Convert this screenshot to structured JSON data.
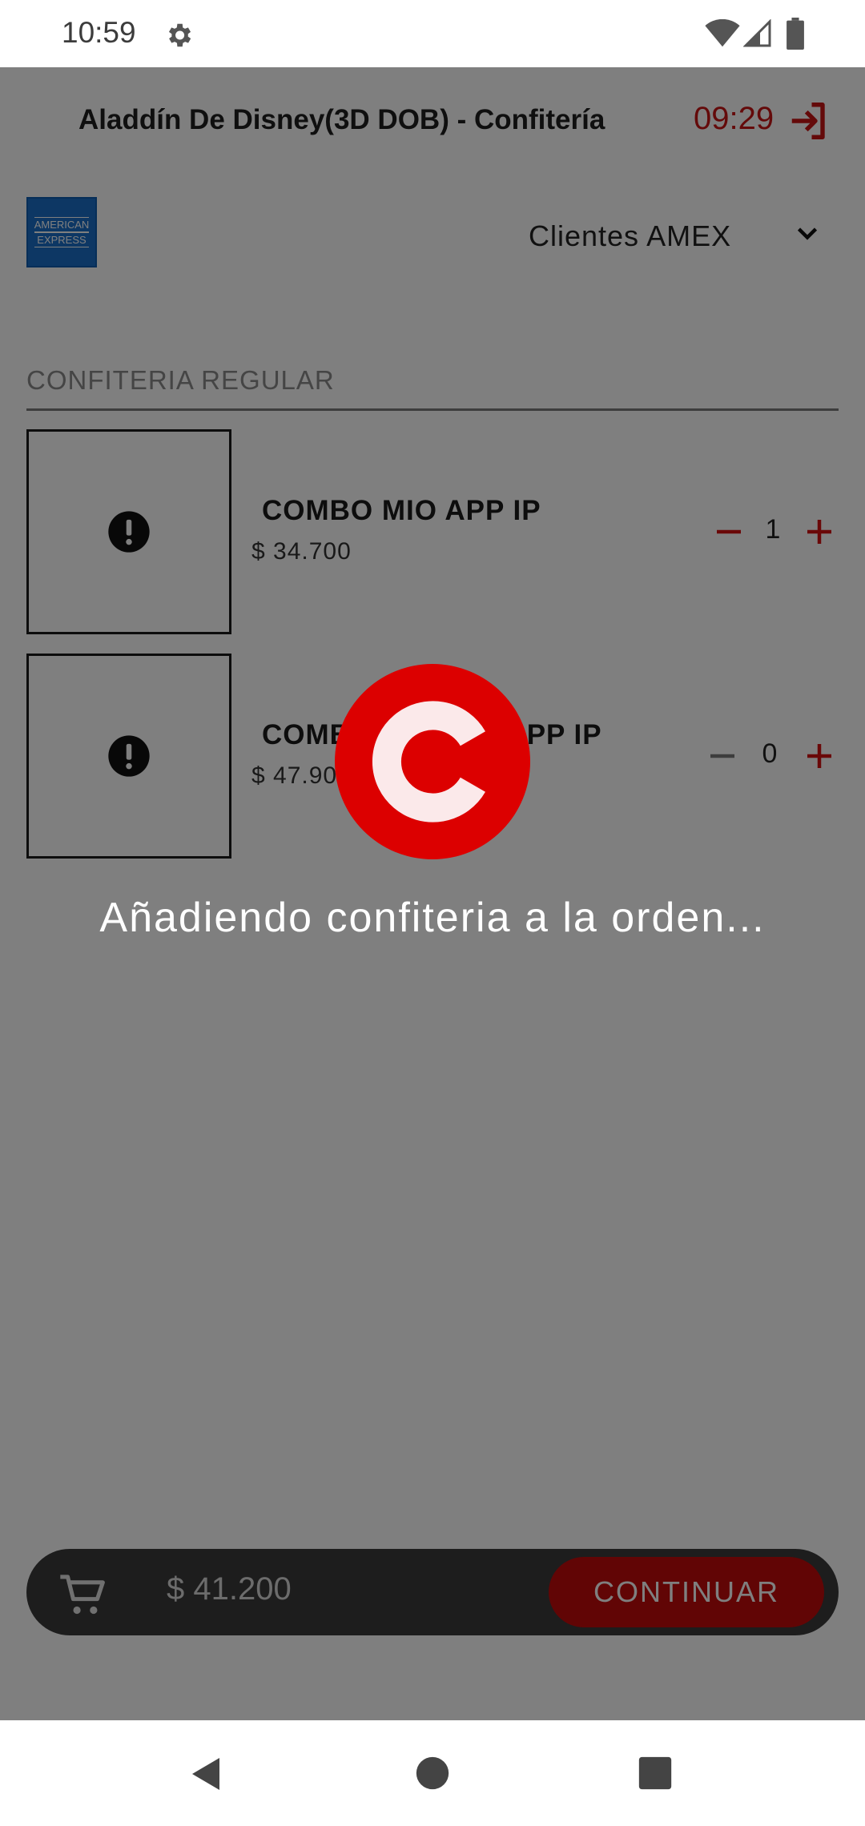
{
  "status_bar": {
    "time": "10:59",
    "icons": [
      "gear-icon",
      "wifi-icon",
      "signal-icon",
      "battery-icon"
    ]
  },
  "header": {
    "title": "Aladdín De Disney(3D DOB) - Confitería",
    "timer": "09:29",
    "exit_icon": "exit-icon"
  },
  "payment": {
    "logo_text_line1": "AMERICAN",
    "logo_text_line2": "EXPRESS",
    "selected_option": "Clientes AMEX"
  },
  "section": {
    "title": "CONFITERIA REGULAR"
  },
  "products": [
    {
      "name": "COMBO MIO APP IP",
      "price": "$ 34.700",
      "quantity": "1"
    },
    {
      "name": "COMBO TU Y YO APP IP",
      "price": "$ 47.900",
      "quantity": "0"
    }
  ],
  "cart": {
    "total": "$ 41.200",
    "continue_label": "CONTINUAR"
  },
  "overlay": {
    "message": "Añadiendo confiteria a la orden..."
  },
  "colors": {
    "accent_red": "#dc0000",
    "text_dark": "#1a1a1a",
    "overlay": "rgba(0,0,0,0.5)"
  }
}
